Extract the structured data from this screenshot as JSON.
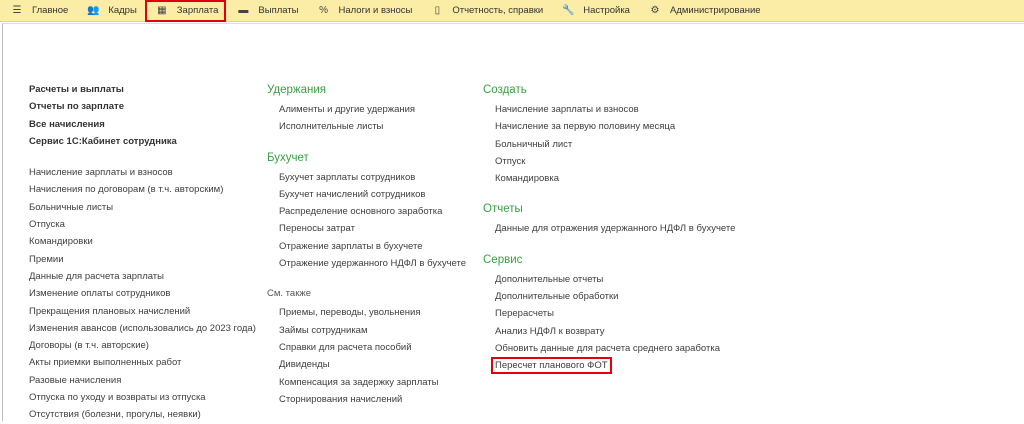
{
  "topbar": [
    {
      "label": "Главное",
      "icon": "menu-icon",
      "glyph": "☰"
    },
    {
      "label": "Кадры",
      "icon": "people-icon",
      "glyph": "👥"
    },
    {
      "label": "Зарплата",
      "icon": "calculator-icon",
      "glyph": "▦",
      "active": true
    },
    {
      "label": "Выплаты",
      "icon": "wallet-icon",
      "glyph": "▬"
    },
    {
      "label": "Налоги и взносы",
      "icon": "percent-icon",
      "glyph": "%"
    },
    {
      "label": "Отчетность, справки",
      "icon": "report-icon",
      "glyph": "▯"
    },
    {
      "label": "Настройка",
      "icon": "wrench-icon",
      "glyph": "🔧"
    },
    {
      "label": "Администрирование",
      "icon": "gear-icon",
      "glyph": "⚙"
    }
  ],
  "left": {
    "bold": [
      "Расчеты и выплаты",
      "Отчеты по зарплате",
      "Все начисления",
      "Сервис 1С:Кабинет сотрудника"
    ],
    "items": [
      "Начисление зарплаты и взносов",
      "Начисления по договорам (в т.ч. авторским)",
      "Больничные листы",
      "Отпуска",
      "Командировки",
      "Премии",
      "Данные для расчета зарплаты",
      "Изменение оплаты сотрудников",
      "Прекращения плановых начислений",
      "Изменения авансов (использовались до 2023 года)",
      "Договоры (в т.ч. авторские)",
      "Акты приемки выполненных работ",
      "Разовые начисления",
      "Отпуска по уходу и возвраты из отпуска",
      "Отсутствия (болезни, прогулы, неявки)"
    ]
  },
  "middle": [
    {
      "title": "Удержания",
      "items": [
        "Алименты и другие удержания",
        "Исполнительные листы"
      ]
    },
    {
      "title": "Бухучет",
      "items": [
        "Бухучет зарплаты сотрудников",
        "Бухучет начислений сотрудников",
        "Распределение основного заработка",
        "Переносы затрат",
        "Отражение зарплаты в бухучете",
        "Отражение удержанного НДФЛ в бухучете"
      ]
    },
    {
      "subtitle": "См. также",
      "items": [
        "Приемы, переводы, увольнения",
        "Займы сотрудникам",
        "Справки для расчета пособий",
        "Дивиденды",
        "Компенсация за задержку зарплаты",
        "Сторнирования начислений"
      ]
    }
  ],
  "right": [
    {
      "title": "Создать",
      "items": [
        "Начисление зарплаты и взносов",
        "Начисление за первую половину месяца",
        "Больничный лист",
        "Отпуск",
        "Командировка"
      ]
    },
    {
      "title": "Отчеты",
      "items": [
        "Данные для отражения удержанного НДФЛ в бухучете"
      ]
    },
    {
      "title": "Сервис",
      "items": [
        "Дополнительные отчеты",
        "Дополнительные обработки",
        "Перерасчеты",
        "Анализ НДФЛ к возврату",
        "Обновить данные для расчета среднего заработка",
        "Пересчет планового ФОТ"
      ],
      "highlighted": "Пересчет планового ФОТ"
    }
  ],
  "colors": {
    "toolbar": "#fbeda5",
    "section_heading": "#3aa044",
    "highlight": "#e0000f"
  }
}
